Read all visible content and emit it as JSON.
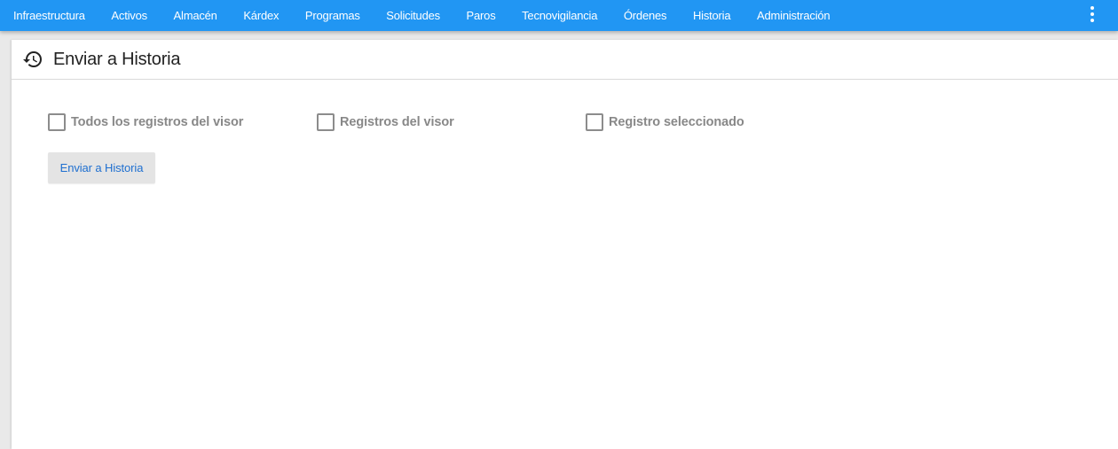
{
  "nav": {
    "items": [
      {
        "label": "Infraestructura"
      },
      {
        "label": "Activos"
      },
      {
        "label": "Almacén"
      },
      {
        "label": "Kárdex"
      },
      {
        "label": "Programas"
      },
      {
        "label": "Solicitudes"
      },
      {
        "label": "Paros"
      },
      {
        "label": "Tecnovigilancia"
      },
      {
        "label": "Órdenes"
      },
      {
        "label": "Historia"
      },
      {
        "label": "Administración"
      }
    ],
    "menu_icon": "more-vert-icon"
  },
  "panel": {
    "icon": "history-icon",
    "title": "Enviar a Historia",
    "options": [
      {
        "label": "Todos los registros del visor",
        "checked": false
      },
      {
        "label": "Registros del visor",
        "checked": false
      },
      {
        "label": "Registro seleccionado",
        "checked": false
      }
    ],
    "button_label": "Enviar a Historia"
  },
  "colors": {
    "topbar": "#2196f3",
    "button_text": "#1e6fd0",
    "button_bg": "#e4e4e4"
  }
}
